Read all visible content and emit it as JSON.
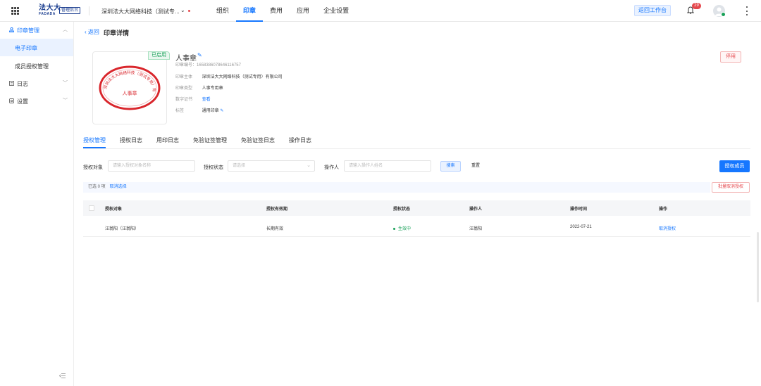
{
  "topbar": {
    "logo_cn": "法大大",
    "logo_en": "FADADA",
    "admin_badge": "管理后台",
    "company": "深圳法大大网络科技（测试专...",
    "nav": [
      {
        "label": "组织",
        "active": false
      },
      {
        "label": "印章",
        "active": true
      },
      {
        "label": "费用",
        "active": false
      },
      {
        "label": "应用",
        "active": false
      },
      {
        "label": "企业设置",
        "active": false
      }
    ],
    "back_workspace": "返回工作台",
    "notification_count": "29"
  },
  "sidebar": {
    "seal_mgmt": "印章管理",
    "electronic_seal": "电子印章",
    "member_auth": "成员授权管理",
    "log": "日志",
    "settings": "设置"
  },
  "page": {
    "back": "返回",
    "title": "印章详情"
  },
  "seal": {
    "status_tag": "已启用",
    "name": "人事章",
    "id_label": "印章编号：",
    "id": "1658386078646116757",
    "stamp_center_text": "人事章",
    "stamp_ring_text": "深圳法大大网络科技（测试专用）有限公司",
    "rows": [
      {
        "key": "印章主体",
        "value": "深圳法大大网络科技（测试专用）有限公司"
      },
      {
        "key": "印章类型",
        "value": "人事专用章"
      },
      {
        "key": "数字证书",
        "value": "查看"
      },
      {
        "key": "标签",
        "value": "通用印章"
      }
    ],
    "disable_btn": "停用"
  },
  "tabs": [
    "授权管理",
    "授权日志",
    "用印日志",
    "免验证签管理",
    "免验证签日志",
    "操作日志"
  ],
  "filters": {
    "target_label": "授权对象",
    "target_placeholder": "请输入授权对象名称",
    "status_label": "授权状态",
    "status_placeholder": "请选择",
    "operator_label": "操作人",
    "operator_placeholder": "请输入操作人姓名",
    "search_btn": "搜索",
    "reset_btn": "重置",
    "auth_btn": "授权成员"
  },
  "selection": {
    "selected_text": "已选 0 项",
    "cancel": "取消选择",
    "batch_cancel": "批量取消授权"
  },
  "table": {
    "headers": [
      "授权对象",
      "授权有效期",
      "授权状态",
      "操作人",
      "操作时间",
      "操作"
    ],
    "rows": [
      {
        "target": "汪翁阳（汪翁阳）",
        "validity": "长期有效",
        "status": "生效中",
        "operator": "汪翁阳",
        "time": "2022-07-21",
        "action": "取消授权"
      }
    ]
  },
  "colors": {
    "primary": "#1677ff",
    "danger": "#e5484d",
    "success": "#18a058",
    "stamp_red": "#d9262c"
  }
}
